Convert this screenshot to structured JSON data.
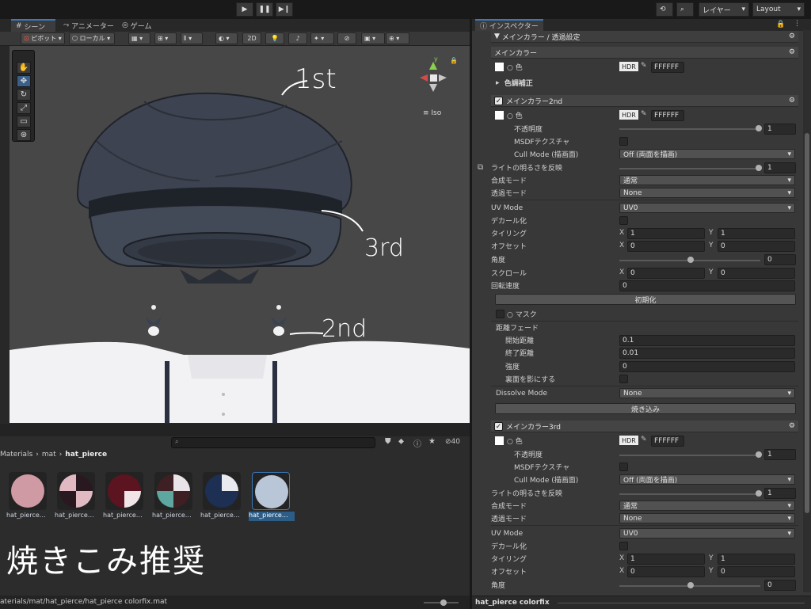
{
  "toolbar": {
    "account_label": "レイヤー",
    "layout_label": "Layout"
  },
  "scene": {
    "tabs": [
      "シーン",
      "アニメーター",
      "ゲーム"
    ],
    "tool_pivot": "ピボット",
    "tool_local": "ローカル",
    "tool_2d": "2D",
    "iso_label": "≡ Iso",
    "gizmo_y": "y"
  },
  "annotations": {
    "first": "1st",
    "third": "3rd",
    "second": "2nd",
    "bake_note": "焼きこみ推奨"
  },
  "project": {
    "breadcrumb": [
      "Materials",
      "mat",
      "hat_pierce"
    ],
    "hidden_count": "40",
    "items": [
      "hat_pierce…",
      "hat_pierce…",
      "hat_pierce…",
      "hat_pierce…",
      "hat_pierce…",
      "hat_pierce…"
    ],
    "path": "aterials/mat/hat_pierce/hat_pierce colorfix.mat"
  },
  "inspector": {
    "tab": "インスペクター",
    "section_title": "メインカラー / 透過設定",
    "main_color": {
      "title": "メインカラー",
      "color_label": "○ 色",
      "hdr": "HDR",
      "hex": "FFFFFF",
      "adjust": "色調補正"
    },
    "color2": {
      "title": "メインカラー2nd",
      "color_label": "○ 色",
      "hdr": "HDR",
      "hex": "FFFFFF",
      "opacity_label": "不透明度",
      "opacity": "1",
      "msdf_label": "MSDFテクスチャ",
      "cull_label": "Cull Mode (描画面)",
      "cull_value": "Off (両面を描画)",
      "light_label": "ライトの明るさを反映",
      "light": "1",
      "blend_label": "合成モード",
      "blend_value": "通常",
      "alpha_label": "透過モード",
      "alpha_value": "None",
      "uv_label": "UV Mode",
      "uv_value": "UV0",
      "decal_label": "デカール化",
      "tiling_label": "タイリング",
      "tiling_x": "1",
      "tiling_y": "1",
      "offset_label": "オフセット",
      "offset_x": "0",
      "offset_y": "0",
      "angle_label": "角度",
      "angle": "0",
      "scroll_label": "スクロール",
      "scroll_x": "0",
      "scroll_y": "0",
      "rot_label": "回転速度",
      "rot": "0",
      "reset_btn": "初期化",
      "mask_label": "○ マスク",
      "dist_label": "距離フェード",
      "start_label": "開始距離",
      "start": "0.1",
      "end_label": "終了距離",
      "end": "0.01",
      "strength_label": "強度",
      "strength": "0",
      "back_label": "裏面を影にする",
      "dissolve_label": "Dissolve Mode",
      "dissolve_value": "None",
      "bake_btn": "焼き込み"
    },
    "color3": {
      "title": "メインカラー3rd",
      "color_label": "○ 色",
      "hdr": "HDR",
      "hex": "FFFFFF",
      "opacity_label": "不透明度",
      "opacity": "1",
      "msdf_label": "MSDFテクスチャ",
      "cull_label": "Cull Mode (描画面)",
      "cull_value": "Off (両面を描画)",
      "light_label": "ライトの明るさを反映",
      "light": "1",
      "blend_label": "合成モード",
      "blend_value": "通常",
      "alpha_label": "透過モード",
      "alpha_value": "None",
      "uv_label": "UV Mode",
      "uv_value": "UV0",
      "decal_label": "デカール化",
      "tiling_label": "タイリング",
      "tiling_x": "1",
      "tiling_y": "1",
      "offset_label": "オフセット",
      "offset_x": "0",
      "offset_y": "0",
      "angle_label": "角度",
      "angle": "0"
    },
    "footer": "hat_pierce colorfix",
    "x": "X",
    "y": "Y"
  }
}
